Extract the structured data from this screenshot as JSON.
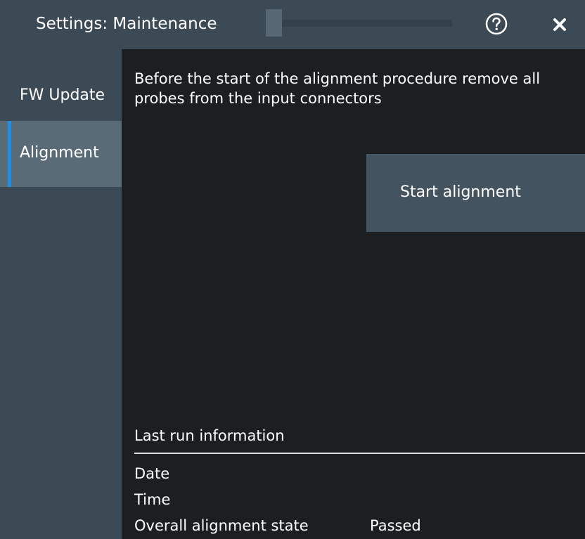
{
  "window": {
    "title": "Settings: Maintenance"
  },
  "icons": {
    "help": "help-circle-icon",
    "close": "close-icon"
  },
  "sidebar": {
    "tabs": [
      {
        "label": "FW Update",
        "selected": false
      },
      {
        "label": "Alignment",
        "selected": true
      }
    ]
  },
  "alignment": {
    "instruction": "Before the start of the alignment procedure remove all probes from the input connectors",
    "start_button_label": "Start alignment",
    "last_run": {
      "heading": "Last run information",
      "date_label": "Date",
      "time_label": "Time",
      "state_label": "Overall alignment state",
      "state_value": "Passed"
    }
  },
  "colors": {
    "panel": "#3c4a55",
    "background": "#1b1f22",
    "selected_tab": "#5a6b78",
    "accent": "#1e8fe0",
    "button": "#445360"
  }
}
